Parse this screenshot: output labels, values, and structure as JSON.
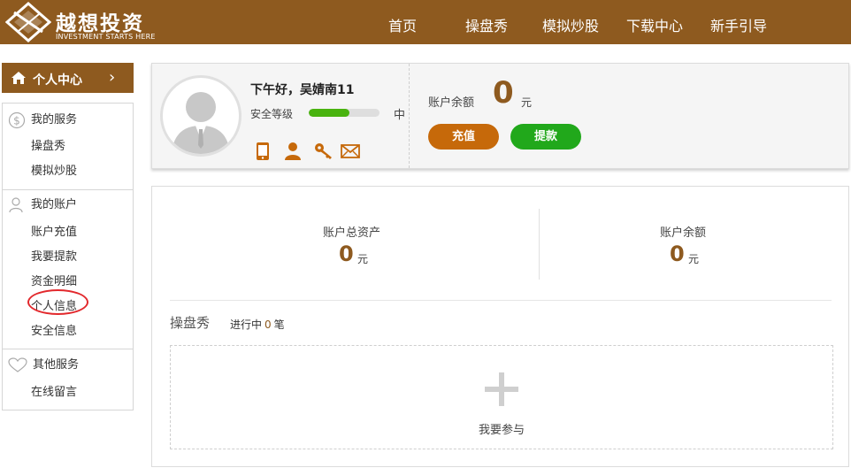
{
  "header": {
    "logo_cn": "越想投资",
    "logo_en": "INVESTMENT STARTS HERE",
    "nav": [
      "首页",
      "操盘秀",
      "模拟炒股",
      "下载中心",
      "新手引导"
    ]
  },
  "sidebar": {
    "head_label": "个人中心",
    "sections": [
      {
        "title": "我的服务",
        "items": [
          "操盘秀",
          "模拟炒股"
        ]
      },
      {
        "title": "我的账户",
        "items": [
          "账户充值",
          "我要提款",
          "资金明细",
          "个人信息",
          "安全信息"
        ]
      },
      {
        "title": "其他服务",
        "items": [
          "在线留言"
        ]
      }
    ]
  },
  "profile": {
    "greeting": "下午好，吴婧南11",
    "security_label": "安全等级",
    "security_level": "中",
    "security_fraction": 0.58,
    "balance_label": "账户余额",
    "balance_value": "0",
    "balance_unit": "元",
    "charge_button": "充值",
    "withdraw_button": "提款"
  },
  "stats": {
    "total_assets_label": "账户总资产",
    "total_assets_value": "0",
    "total_assets_unit": "元",
    "balance_label": "账户余额",
    "balance_value": "0",
    "balance_unit": "元"
  },
  "caopanxiu": {
    "title": "操盘秀",
    "status_prefix": "进行中",
    "count": "0",
    "status_suffix": "笔",
    "join_label": "我要参与"
  },
  "colors": {
    "brand": "#8e5a1f",
    "charge": "#c6690a",
    "withdraw": "#21a81b",
    "highlight": "#e2282c"
  }
}
